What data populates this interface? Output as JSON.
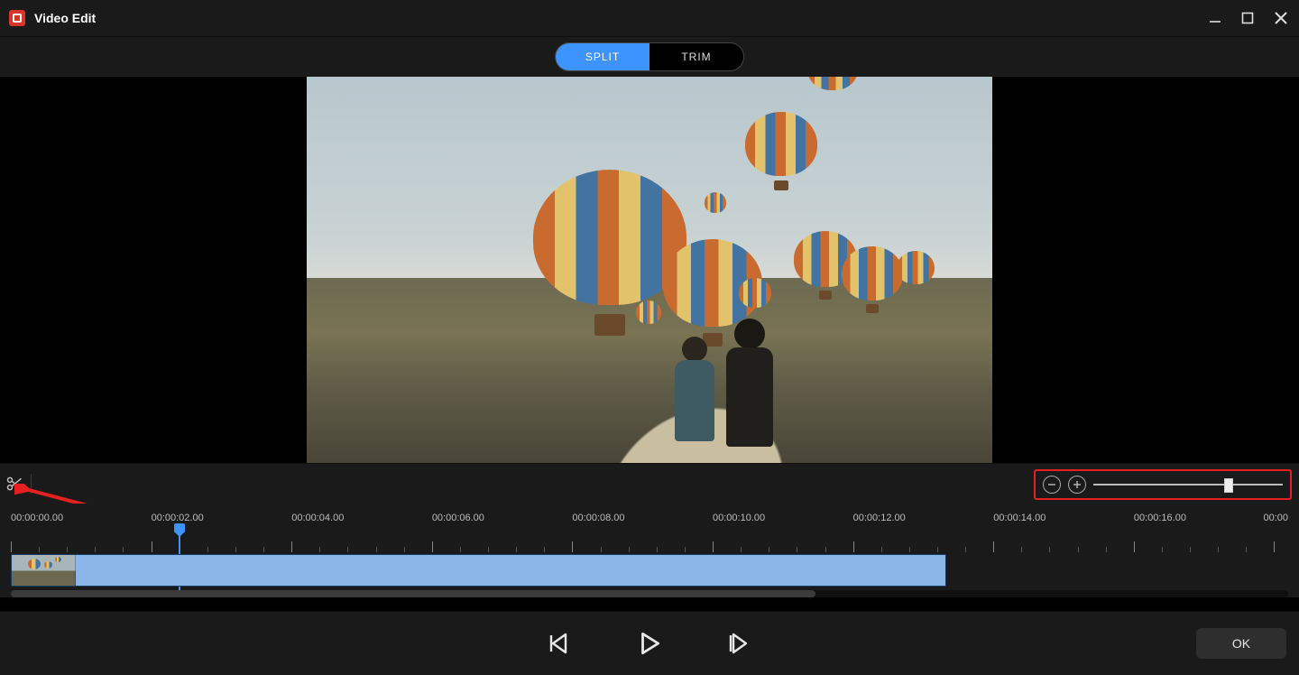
{
  "window": {
    "title": "Video Edit"
  },
  "tabs": {
    "split": "SPLIT",
    "trim": "TRIM",
    "active": "split"
  },
  "timeline": {
    "tick_labels": [
      "00:00:00.00",
      "00:00:02.00",
      "00:00:04.00",
      "00:00:06.00",
      "00:00:08.00",
      "00:00:10.00",
      "00:00:12.00",
      "00:00:14.00",
      "00:00:16.00"
    ],
    "end_label_partial": "00:00",
    "playhead_seconds": 2.4,
    "ruler_span_seconds": 18.2,
    "clip_end_seconds": 13.3,
    "scroll_fraction": 0.63,
    "zoom_fraction": 0.72
  },
  "buttons": {
    "ok": "OK"
  }
}
